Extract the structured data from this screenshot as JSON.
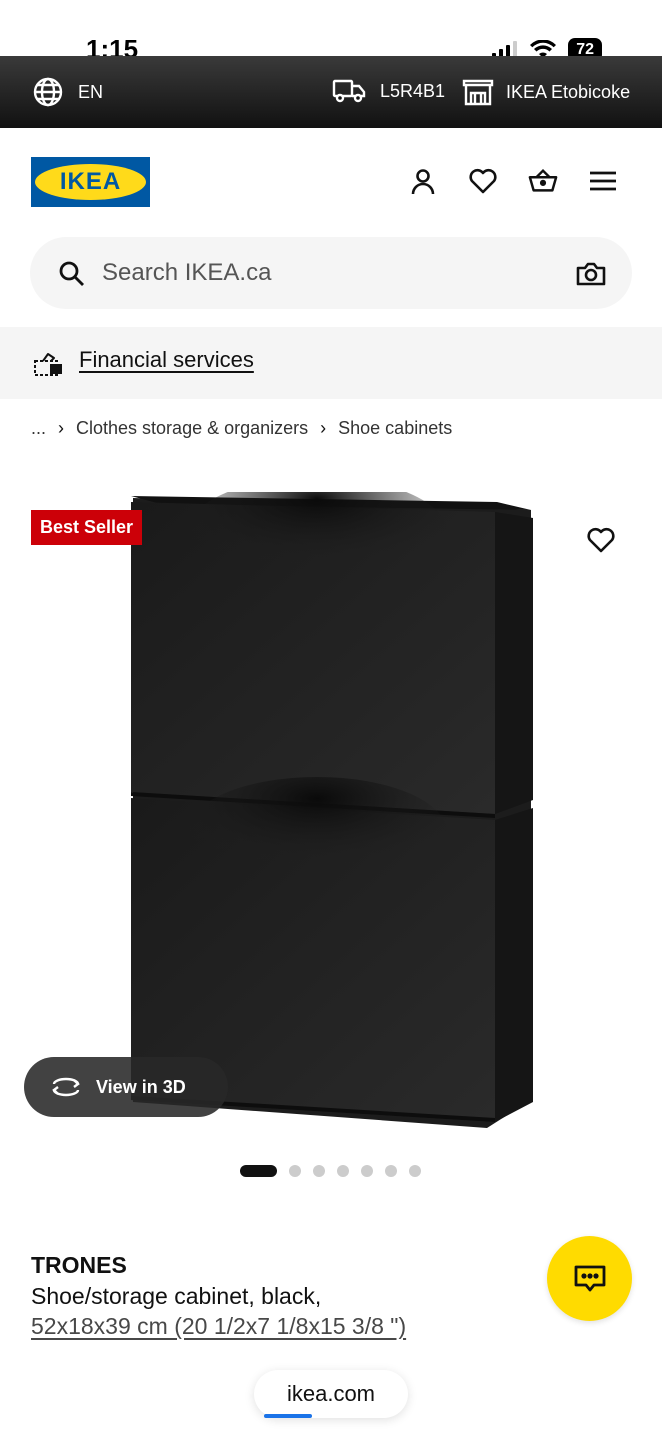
{
  "status_bar": {
    "time": "1:15",
    "battery": "72"
  },
  "top_bar": {
    "language": "EN",
    "postal_code": "L5R4B1",
    "store": "IKEA Etobicoke"
  },
  "header": {
    "logo_text": "IKEA"
  },
  "search": {
    "placeholder": "Search IKEA.ca"
  },
  "financial": {
    "label": "Financial services"
  },
  "breadcrumb": {
    "ellipsis": "...",
    "items": [
      "Clothes storage & organizers",
      "Shoe cabinets"
    ]
  },
  "product": {
    "badge": "Best Seller",
    "view_3d_label": "View in 3D",
    "carousel": {
      "total_images": 7,
      "active_index": 0
    },
    "name": "TRONES",
    "description": "Shoe/storage cabinet, black,",
    "dimensions": "52x18x39 cm (20 1/2x7 1/8x15 3/8 \")"
  },
  "browser": {
    "url": "ikea.com"
  },
  "colors": {
    "ikea_blue": "#0058a3",
    "ikea_yellow": "#ffda1a",
    "badge_red": "#cc0008",
    "chat_yellow": "#ffdb00"
  }
}
